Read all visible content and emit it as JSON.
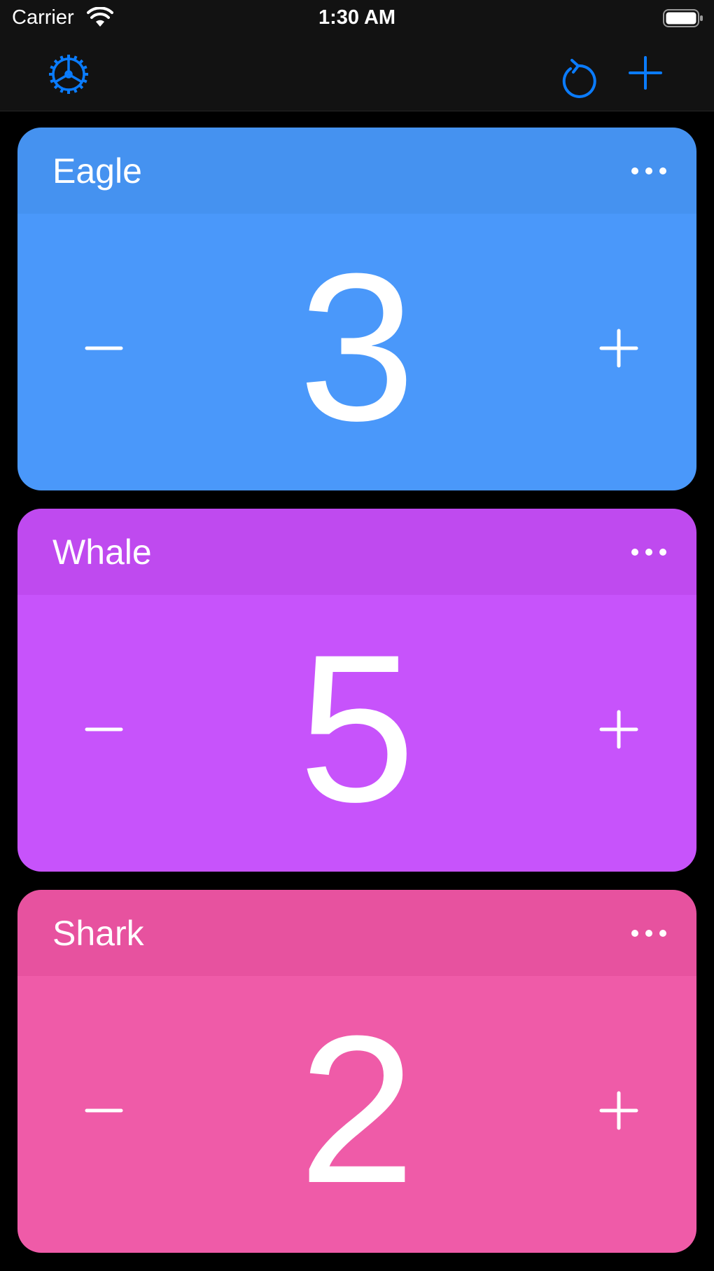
{
  "status_bar": {
    "carrier": "Carrier",
    "time": "1:30 AM"
  },
  "nav_bar": {
    "accent_color": "#0a7cff",
    "left_icon": "settings-gear-icon",
    "right_icons": [
      "reset-icon",
      "add-icon"
    ]
  },
  "counters": [
    {
      "name": "Eagle",
      "count": "3",
      "header_color": "#4592f0",
      "body_color": "#4a98fa",
      "more_icon": "ellipsis-icon",
      "decrement_icon": "minus-icon",
      "increment_icon": "plus-icon"
    },
    {
      "name": "Whale",
      "count": "5",
      "header_color": "#bf4aef",
      "body_color": "#c753fb",
      "more_icon": "ellipsis-icon",
      "decrement_icon": "minus-icon",
      "increment_icon": "plus-icon"
    },
    {
      "name": "Shark",
      "count": "2",
      "header_color": "#e7529f",
      "body_color": "#ef5ba8",
      "more_icon": "ellipsis-icon",
      "decrement_icon": "minus-icon",
      "increment_icon": "plus-icon"
    }
  ]
}
